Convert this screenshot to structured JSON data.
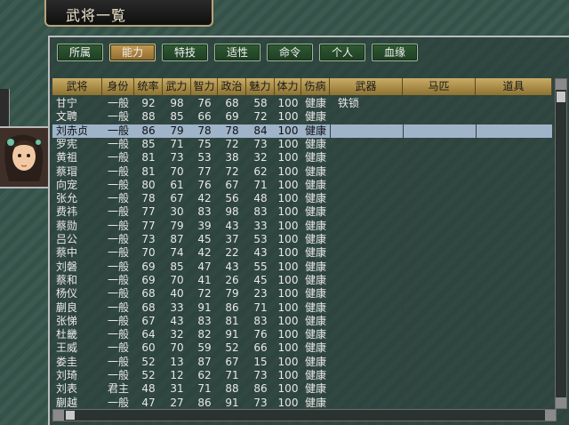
{
  "title": "武将一覧",
  "tabs": [
    "所属",
    "能力",
    "特技",
    "适性",
    "命令",
    "个人",
    "血缘"
  ],
  "active_tab_index": 1,
  "columns": [
    "武将",
    "身份",
    "统率",
    "武力",
    "智力",
    "政治",
    "魅力",
    "体力",
    "伤病",
    "武器",
    "马匹",
    "道具"
  ],
  "rows": [
    {
      "name": "甘宁",
      "rank": "一般",
      "lead": "92",
      "war": "98",
      "int": "76",
      "pol": "68",
      "chr": "58",
      "hp": "100",
      "inj": "健康",
      "weapon": "铁锁",
      "horse": "",
      "item": ""
    },
    {
      "name": "文聘",
      "rank": "一般",
      "lead": "88",
      "war": "85",
      "int": "66",
      "pol": "69",
      "chr": "72",
      "hp": "100",
      "inj": "健康",
      "weapon": "",
      "horse": "",
      "item": ""
    },
    {
      "name": "刘赤贞",
      "rank": "一般",
      "lead": "86",
      "war": "79",
      "int": "78",
      "pol": "78",
      "chr": "84",
      "hp": "100",
      "inj": "健康",
      "weapon": "",
      "horse": "",
      "item": ""
    },
    {
      "name": "罗宪",
      "rank": "一般",
      "lead": "85",
      "war": "71",
      "int": "75",
      "pol": "72",
      "chr": "73",
      "hp": "100",
      "inj": "健康",
      "weapon": "",
      "horse": "",
      "item": ""
    },
    {
      "name": "黄祖",
      "rank": "一般",
      "lead": "81",
      "war": "73",
      "int": "53",
      "pol": "38",
      "chr": "32",
      "hp": "100",
      "inj": "健康",
      "weapon": "",
      "horse": "",
      "item": ""
    },
    {
      "name": "蔡瑁",
      "rank": "一般",
      "lead": "81",
      "war": "70",
      "int": "77",
      "pol": "72",
      "chr": "62",
      "hp": "100",
      "inj": "健康",
      "weapon": "",
      "horse": "",
      "item": ""
    },
    {
      "name": "向宠",
      "rank": "一般",
      "lead": "80",
      "war": "61",
      "int": "76",
      "pol": "67",
      "chr": "71",
      "hp": "100",
      "inj": "健康",
      "weapon": "",
      "horse": "",
      "item": ""
    },
    {
      "name": "张允",
      "rank": "一般",
      "lead": "78",
      "war": "67",
      "int": "42",
      "pol": "56",
      "chr": "48",
      "hp": "100",
      "inj": "健康",
      "weapon": "",
      "horse": "",
      "item": ""
    },
    {
      "name": "费祎",
      "rank": "一般",
      "lead": "77",
      "war": "30",
      "int": "83",
      "pol": "98",
      "chr": "83",
      "hp": "100",
      "inj": "健康",
      "weapon": "",
      "horse": "",
      "item": ""
    },
    {
      "name": "蔡勋",
      "rank": "一般",
      "lead": "77",
      "war": "79",
      "int": "39",
      "pol": "43",
      "chr": "33",
      "hp": "100",
      "inj": "健康",
      "weapon": "",
      "horse": "",
      "item": ""
    },
    {
      "name": "吕公",
      "rank": "一般",
      "lead": "73",
      "war": "87",
      "int": "45",
      "pol": "37",
      "chr": "53",
      "hp": "100",
      "inj": "健康",
      "weapon": "",
      "horse": "",
      "item": ""
    },
    {
      "name": "蔡中",
      "rank": "一般",
      "lead": "70",
      "war": "74",
      "int": "42",
      "pol": "22",
      "chr": "43",
      "hp": "100",
      "inj": "健康",
      "weapon": "",
      "horse": "",
      "item": ""
    },
    {
      "name": "刘磐",
      "rank": "一般",
      "lead": "69",
      "war": "85",
      "int": "47",
      "pol": "43",
      "chr": "55",
      "hp": "100",
      "inj": "健康",
      "weapon": "",
      "horse": "",
      "item": ""
    },
    {
      "name": "蔡和",
      "rank": "一般",
      "lead": "69",
      "war": "70",
      "int": "41",
      "pol": "26",
      "chr": "45",
      "hp": "100",
      "inj": "健康",
      "weapon": "",
      "horse": "",
      "item": ""
    },
    {
      "name": "杨仪",
      "rank": "一般",
      "lead": "68",
      "war": "40",
      "int": "72",
      "pol": "79",
      "chr": "23",
      "hp": "100",
      "inj": "健康",
      "weapon": "",
      "horse": "",
      "item": ""
    },
    {
      "name": "蒯良",
      "rank": "一般",
      "lead": "68",
      "war": "33",
      "int": "91",
      "pol": "86",
      "chr": "71",
      "hp": "100",
      "inj": "健康",
      "weapon": "",
      "horse": "",
      "item": ""
    },
    {
      "name": "张悌",
      "rank": "一般",
      "lead": "67",
      "war": "43",
      "int": "83",
      "pol": "81",
      "chr": "83",
      "hp": "100",
      "inj": "健康",
      "weapon": "",
      "horse": "",
      "item": ""
    },
    {
      "name": "杜畿",
      "rank": "一般",
      "lead": "64",
      "war": "32",
      "int": "82",
      "pol": "91",
      "chr": "76",
      "hp": "100",
      "inj": "健康",
      "weapon": "",
      "horse": "",
      "item": ""
    },
    {
      "name": "王威",
      "rank": "一般",
      "lead": "60",
      "war": "70",
      "int": "59",
      "pol": "52",
      "chr": "66",
      "hp": "100",
      "inj": "健康",
      "weapon": "",
      "horse": "",
      "item": ""
    },
    {
      "name": "娄圭",
      "rank": "一般",
      "lead": "52",
      "war": "13",
      "int": "87",
      "pol": "67",
      "chr": "15",
      "hp": "100",
      "inj": "健康",
      "weapon": "",
      "horse": "",
      "item": ""
    },
    {
      "name": "刘琦",
      "rank": "一般",
      "lead": "52",
      "war": "12",
      "int": "62",
      "pol": "71",
      "chr": "73",
      "hp": "100",
      "inj": "健康",
      "weapon": "",
      "horse": "",
      "item": ""
    },
    {
      "name": "刘表",
      "rank": "君主",
      "lead": "48",
      "war": "31",
      "int": "71",
      "pol": "88",
      "chr": "86",
      "hp": "100",
      "inj": "健康",
      "weapon": "",
      "horse": "",
      "item": ""
    },
    {
      "name": "蒯越",
      "rank": "一般",
      "lead": "47",
      "war": "27",
      "int": "86",
      "pol": "91",
      "chr": "73",
      "hp": "100",
      "inj": "健康",
      "weapon": "",
      "horse": "",
      "item": ""
    }
  ],
  "selected_row_index": 2,
  "colors": {
    "tab_bg": "#254a2a",
    "tab_active": "#b48a45",
    "header_bg": "#b29649",
    "selected_row": "#9fb4c9"
  }
}
